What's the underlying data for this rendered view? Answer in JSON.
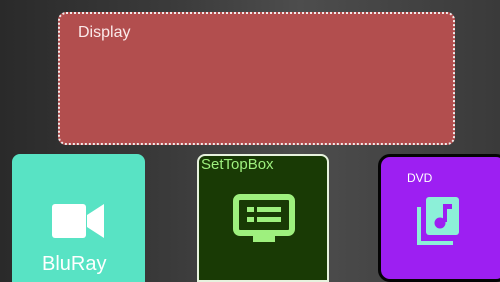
{
  "display": {
    "label": "Display"
  },
  "tiles": {
    "bluray": {
      "label": "BluRay",
      "icon": "video-camera-icon",
      "color": "#58e3c4"
    },
    "settopbox": {
      "label": "SetTopBox",
      "icon": "tv-guide-icon",
      "color": "#193a05"
    },
    "dvd": {
      "label": "DVD",
      "icon": "music-library-icon",
      "color": "#9d1ff2"
    }
  }
}
